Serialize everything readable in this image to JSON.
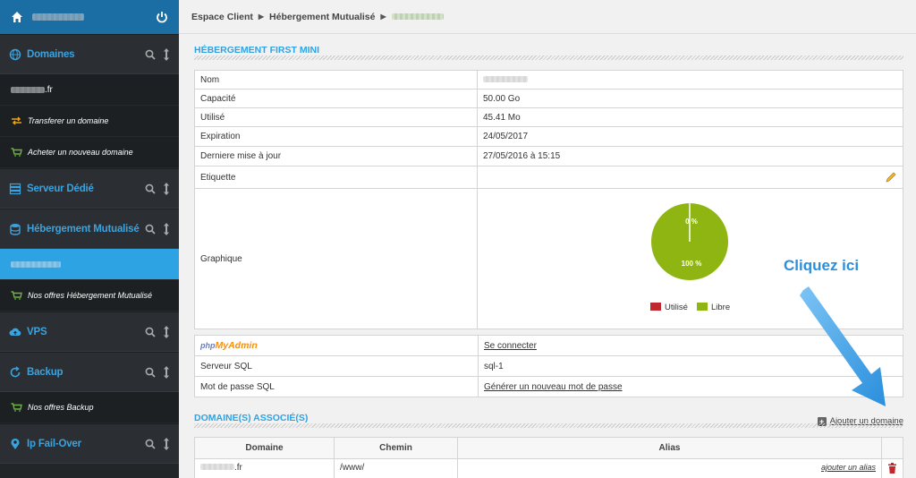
{
  "sidebar": {
    "sections": [
      {
        "label": "Domaines"
      },
      {
        "label": "Serveur Dédié"
      },
      {
        "label": "Hébergement Mutualisé"
      },
      {
        "label": "VPS"
      },
      {
        "label": "Backup"
      },
      {
        "label": "Ip Fail-Over"
      }
    ],
    "items": {
      "domain_suffix": ".fr",
      "transfer": "Transferer un domaine",
      "buy": "Acheter un nouveau domaine",
      "hosting_offers": "Nos offres Hébergement Mutualisé",
      "backup_offers": "Nos offres Backup"
    }
  },
  "breadcrumb": {
    "items": [
      "Espace Client",
      "Hébergement Mutualisé"
    ]
  },
  "hosting": {
    "title": "HÉBERGEMENT FIRST MINI",
    "rows": [
      {
        "key": "Nom",
        "value": ""
      },
      {
        "key": "Capacité",
        "value": "50.00 Go"
      },
      {
        "key": "Utilisé",
        "value": "45.41 Mo"
      },
      {
        "key": "Expiration",
        "value": "24/05/2017"
      },
      {
        "key": "Derniere mise à jour",
        "value": "27/05/2016 à 15:15"
      },
      {
        "key": "Etiquette",
        "value": ""
      },
      {
        "key": "Graphique",
        "value": ""
      }
    ],
    "chart": {
      "label_used": "0 %",
      "label_free": "100 %",
      "legend_used": "Utilisé",
      "legend_free": "Libre"
    }
  },
  "sql": {
    "pma_php": "php",
    "pma_my": "MyAdmin",
    "connect": "Se connecter",
    "server_key": "Serveur SQL",
    "server_value": "sql-1",
    "pwd_key": "Mot de passe SQL",
    "pwd_link": "Générer un nouveau mot de passe"
  },
  "domains": {
    "title": "DOMAINE(S) ASSOCIÉ(S)",
    "add_label": "Ajouter un domaine",
    "columns": [
      "Domaine",
      "Chemin",
      "Alias"
    ],
    "row": {
      "domain_suffix": ".fr",
      "path": "/www/",
      "alias_link": "ajouter un alias"
    }
  },
  "callout": "Cliquez ici",
  "chart_data": {
    "type": "pie",
    "categories": [
      "Utilisé",
      "Libre"
    ],
    "values": [
      0,
      100
    ],
    "colors": [
      "#c0282d",
      "#8fb512"
    ]
  }
}
